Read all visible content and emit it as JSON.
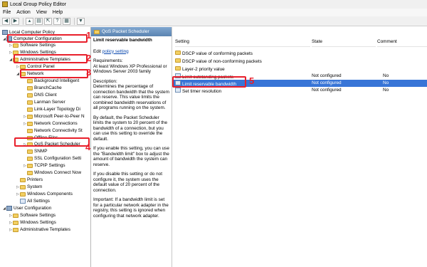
{
  "window": {
    "title": "Local Group Policy Editor"
  },
  "menu": [
    "File",
    "Action",
    "View",
    "Help"
  ],
  "toolbar": {
    "buttons": [
      "back-icon",
      "forward-icon",
      "up-icon",
      "show-hide-tree-icon",
      "export-icon",
      "help-icon",
      "properties-icon",
      "filter-icon"
    ]
  },
  "tree": [
    {
      "label": "Local Computer Policy",
      "icon": "policy-icon",
      "toggle": ""
    },
    {
      "label": "Computer Configuration",
      "icon": "computer-icon",
      "toggle": "◢"
    },
    {
      "label": "Software Settings",
      "icon": "folder-icon",
      "toggle": "▷"
    },
    {
      "label": "Windows Settings",
      "icon": "folder-icon",
      "toggle": "▷"
    },
    {
      "label": "Administrative Templates",
      "icon": "folder-icon",
      "toggle": "◢"
    },
    {
      "label": "Control Panel",
      "icon": "folder-icon",
      "toggle": "▷"
    },
    {
      "label": "Network",
      "icon": "folder-icon",
      "toggle": "◢"
    },
    {
      "label": "Background Intelligent",
      "icon": "folder-icon",
      "toggle": ""
    },
    {
      "label": "BranchCache",
      "icon": "folder-icon",
      "toggle": ""
    },
    {
      "label": "DNS Client",
      "icon": "folder-icon",
      "toggle": ""
    },
    {
      "label": "Lanman Server",
      "icon": "folder-icon",
      "toggle": ""
    },
    {
      "label": "Link-Layer Topology Di",
      "icon": "folder-icon",
      "toggle": ""
    },
    {
      "label": "Microsoft Peer-to-Peer N",
      "icon": "folder-icon",
      "toggle": "▷"
    },
    {
      "label": "Network Connections",
      "icon": "folder-icon",
      "toggle": "▷"
    },
    {
      "label": "Network Connectivity St",
      "icon": "folder-icon",
      "toggle": ""
    },
    {
      "label": "Offline Files",
      "icon": "folder-icon",
      "toggle": ""
    },
    {
      "label": "QoS Packet Scheduler",
      "icon": "folder-icon",
      "toggle": "▷"
    },
    {
      "label": "SNMP",
      "icon": "folder-icon",
      "toggle": ""
    },
    {
      "label": "SSL Configuration Setti",
      "icon": "folder-icon",
      "toggle": ""
    },
    {
      "label": "TCPIP Settings",
      "icon": "folder-icon",
      "toggle": "▷"
    },
    {
      "label": "Windows Connect Now",
      "icon": "folder-icon",
      "toggle": ""
    },
    {
      "label": "Printers",
      "icon": "folder-icon",
      "toggle": ""
    },
    {
      "label": "System",
      "icon": "folder-icon",
      "toggle": "▷"
    },
    {
      "label": "Windows Components",
      "icon": "folder-icon",
      "toggle": "▷"
    },
    {
      "label": "All Settings",
      "icon": "settings-icon",
      "toggle": ""
    },
    {
      "label": "User Configuration",
      "icon": "user-icon",
      "toggle": "◢"
    },
    {
      "label": "Software Settings",
      "icon": "folder-icon",
      "toggle": "▷"
    },
    {
      "label": "Windows Settings",
      "icon": "folder-icon",
      "toggle": "▷"
    },
    {
      "label": "Administrative Templates",
      "icon": "folder-icon",
      "toggle": "▷"
    }
  ],
  "middle": {
    "header": "QoS Packet Scheduler",
    "setting_title": "Limit reservable bandwidth",
    "edit_prefix": "Edit ",
    "edit_link": "policy setting",
    "requirements_label": "Requirements:",
    "requirements_text": "At least Windows XP Professional or Windows Server 2003 family",
    "description_label": "Description:",
    "paragraphs": [
      "Determines the percentage of connection bandwidth that the system can reserve. This value limits the combined bandwidth reservations of all programs running on the system.",
      "By default, the Packet Scheduler limits the system to 20 percent of the bandwidth of a connection, but you can use this setting to override the default.",
      "If you enable this setting, you can use the \"Bandwidth limit\" box to adjust the amount of bandwidth the system can reserve.",
      "If you disable this setting or do not configure it, the system uses the default value of 20 percent of the connection.",
      "Important: If a bandwidth limit is set for a particular network adapter in the registry, this setting is ignored when configuring that network adapter."
    ]
  },
  "list": {
    "columns": [
      "Setting",
      "State",
      "Comment"
    ],
    "rows": [
      {
        "setting": "DSCP value of conforming packets",
        "state": "",
        "comment": "",
        "icon": "folder-icon"
      },
      {
        "setting": "DSCP value of non-conforming packets",
        "state": "",
        "comment": "",
        "icon": "folder-icon"
      },
      {
        "setting": "Layer-2 priority value",
        "state": "",
        "comment": "",
        "icon": "folder-icon"
      },
      {
        "setting": "Limit outstanding packets",
        "state": "Not configured",
        "comment": "No",
        "icon": "setting-icon"
      },
      {
        "setting": "Limit reservable bandwidth",
        "state": "Not configured",
        "comment": "No",
        "icon": "setting-icon"
      },
      {
        "setting": "Set timer resolution",
        "state": "Not configured",
        "comment": "No",
        "icon": "setting-icon"
      }
    ]
  },
  "annotations": [
    "1",
    "2",
    "3",
    "4",
    "5"
  ],
  "colors": {
    "highlight": "#e81f2b",
    "selection": "#3875d7",
    "header": "#5b84b1"
  }
}
